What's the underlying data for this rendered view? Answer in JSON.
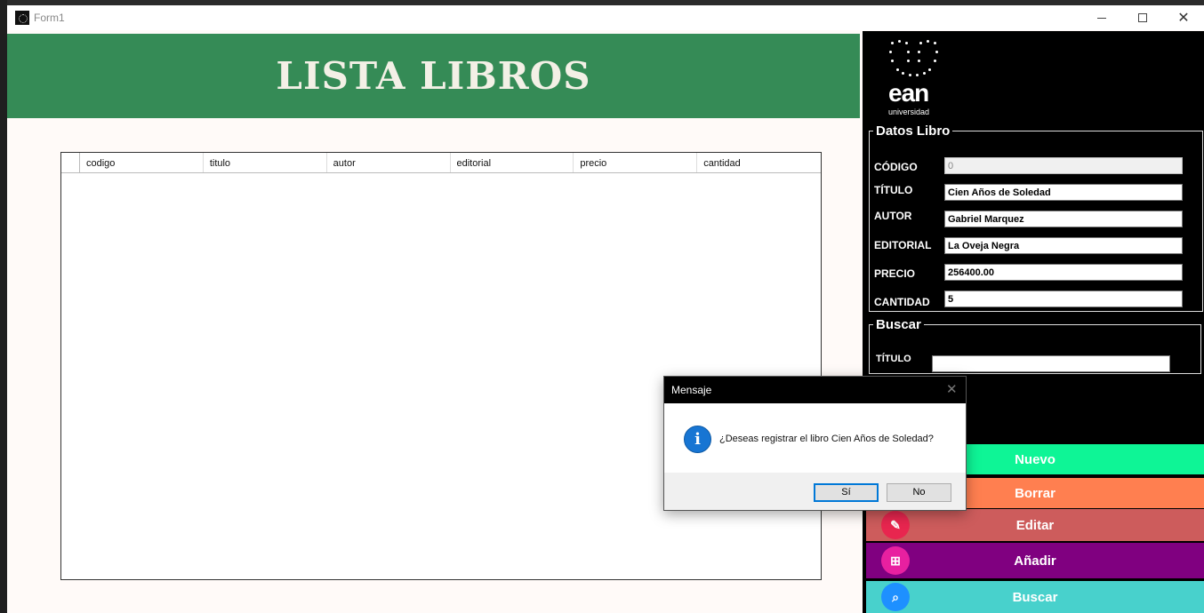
{
  "window": {
    "title": "Form1"
  },
  "header": {
    "title": "LISTA LIBROS"
  },
  "grid": {
    "columns": [
      "codigo",
      "titulo",
      "autor",
      "editorial",
      "precio",
      "cantidad"
    ]
  },
  "logo": {
    "word": "ean",
    "sub": "universidad",
    "icon": "ean-dots-logo"
  },
  "datos": {
    "legend": "Datos Libro",
    "codigo_label": "CÓDIGO",
    "codigo_value": "0",
    "titulo_label": "TÍTULO",
    "titulo_value": "Cien Años de Soledad",
    "autor_label": "AUTOR",
    "autor_value": "Gabriel Marquez",
    "editorial_label": "EDITORIAL",
    "editorial_value": "La Oveja Negra",
    "precio_label": "PRECIO",
    "precio_value": "256400.00",
    "cantidad_label": "CANTIDAD",
    "cantidad_value": "5"
  },
  "buscar": {
    "legend": "Buscar",
    "titulo_label": "TÍTULO",
    "titulo_value": ""
  },
  "actions": {
    "nuevo": "Nuevo",
    "borrar": "Borrar",
    "editar": "Editar",
    "anadir": "Añadir",
    "buscar": "Buscar"
  },
  "dialog": {
    "title": "Mensaje",
    "message": "¿Deseas registrar el libro Cien Años de Soledad?",
    "yes": "Sí",
    "no": "No",
    "icon": "info-icon"
  },
  "colors": {
    "header": "#358b56",
    "nuevo": "#0ef596",
    "borrar": "#ff7f50",
    "editar": "#cd5c5c",
    "anadir": "#800080",
    "buscar": "#48d1cc"
  }
}
